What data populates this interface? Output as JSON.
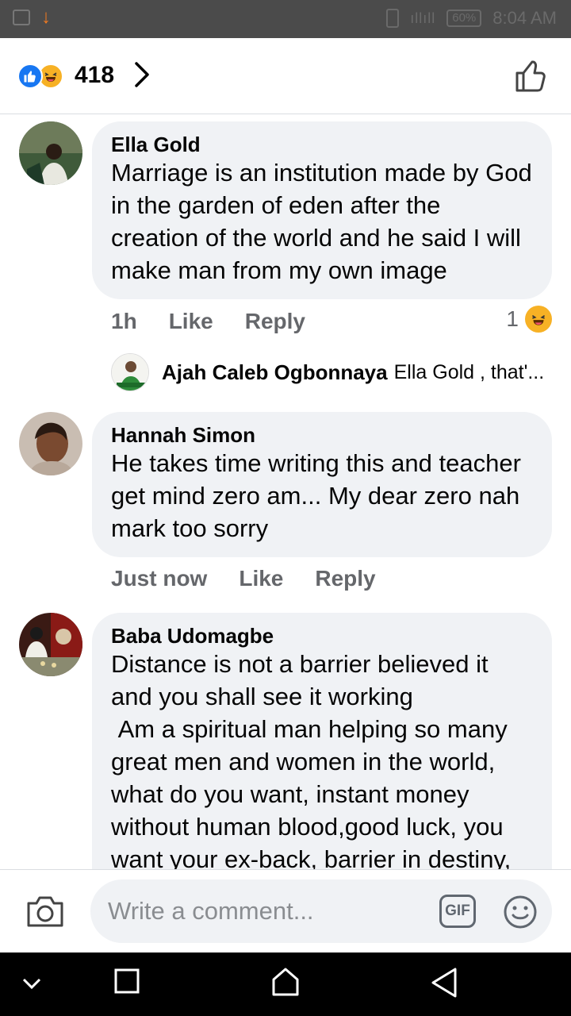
{
  "status_bar": {
    "time": "8:04 AM",
    "battery": "60%",
    "signal_label": "ıllıll"
  },
  "reactions": {
    "count": "418",
    "icons": [
      "like-icon",
      "haha-icon"
    ]
  },
  "comments": [
    {
      "author": "Ella Gold",
      "text": "Marriage is an institution made by God in the garden of eden after the creation of the world and he said I will make man from my own image",
      "time": "1h",
      "like_label": "Like",
      "reply_label": "Reply",
      "reaction_count": "1",
      "reply_preview": {
        "author": "Ajah Caleb Ogbonnaya",
        "text": "Ella Gold , that'..."
      }
    },
    {
      "author": "Hannah Simon",
      "text": "He takes time writing this and teacher get mind zero am... My dear zero nah mark too sorry",
      "time": "Just now",
      "like_label": "Like",
      "reply_label": "Reply"
    },
    {
      "author": "Baba Udomagbe",
      "text": "Distance is not a barrier believed it and you shall see it working\n Am a spiritual man helping so many great men and women in the world, what do you want, instant money without human blood,good luck, you want your ex-back, barrier in destiny,"
    }
  ],
  "composer": {
    "placeholder": "Write a comment...",
    "gif_label": "GIF"
  },
  "colors": {
    "accent": "#1877f2",
    "bubble": "#f0f2f5",
    "meta": "#65676b",
    "haha": "#f7b125"
  }
}
